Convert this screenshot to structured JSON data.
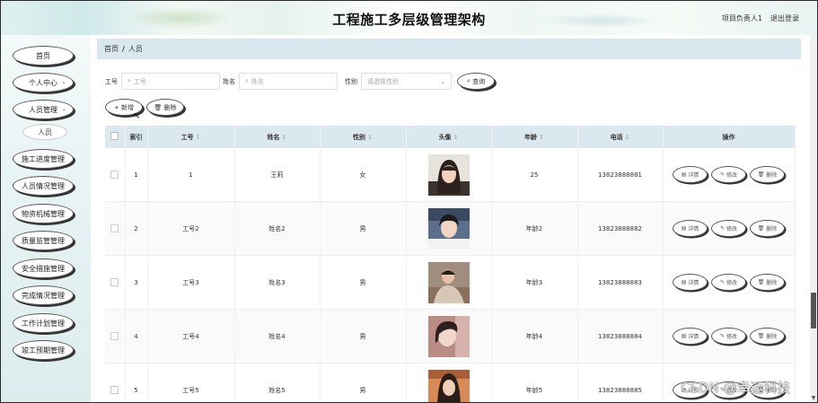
{
  "header": {
    "title": "工程施工多层级管理架构",
    "user": "项目负责人1",
    "logout": "退出登录"
  },
  "sidebar": {
    "items": [
      {
        "label": "首页",
        "chevron": false
      },
      {
        "label": "个人中心",
        "chevron": true
      },
      {
        "label": "人员管理",
        "chevron": true
      },
      {
        "label": "施工进度管理",
        "chevron": false
      },
      {
        "label": "人员情况管理",
        "chevron": false
      },
      {
        "label": "物资机械管理",
        "chevron": false
      },
      {
        "label": "质量监管管理",
        "chevron": false
      },
      {
        "label": "安全措施管理",
        "chevron": false
      },
      {
        "label": "完成情况管理",
        "chevron": false
      },
      {
        "label": "工作计划管理",
        "chevron": false
      },
      {
        "label": "竣工预期管理",
        "chevron": false
      }
    ],
    "sub_item": "人员"
  },
  "breadcrumb": {
    "home": "首页",
    "separator": "/",
    "current": "人员"
  },
  "search": {
    "gonghao_label": "工号",
    "gonghao_placeholder": "工号",
    "name_label": "姓名",
    "name_placeholder": "姓名",
    "gender_label": "性别",
    "gender_placeholder": "请选择性别",
    "query_button": "查询"
  },
  "actions": {
    "add": "新增",
    "delete": "删除"
  },
  "table": {
    "headers": {
      "index": "索引",
      "gonghao": "工号",
      "name": "姓名",
      "gender": "性别",
      "avatar": "头像",
      "age": "年龄",
      "phone": "电话",
      "ops": "操作"
    },
    "buttons": {
      "detail": "详情",
      "edit": "修改",
      "delete": "删除"
    },
    "rows": [
      {
        "index": "1",
        "gonghao": "1",
        "name": "王莉",
        "gender": "女",
        "age": "25",
        "phone": "13823888881"
      },
      {
        "index": "2",
        "gonghao": "工号2",
        "name": "姓名2",
        "gender": "男",
        "age": "年龄2",
        "phone": "13823888882"
      },
      {
        "index": "3",
        "gonghao": "工号3",
        "name": "姓名3",
        "gender": "男",
        "age": "年龄3",
        "phone": "13823888883"
      },
      {
        "index": "4",
        "gonghao": "工号4",
        "name": "姓名4",
        "gender": "男",
        "age": "年龄4",
        "phone": "13823888884"
      },
      {
        "index": "5",
        "gonghao": "工号5",
        "name": "姓名5",
        "gender": "男",
        "age": "年龄5",
        "phone": "13823888885"
      }
    ]
  },
  "watermark": "CSDN @幸运科技",
  "colors": {
    "header_bg": "#dbe8ef",
    "breadcrumb_bg": "#d8e8ee",
    "sidebar_bg": "#e8f3f3"
  }
}
